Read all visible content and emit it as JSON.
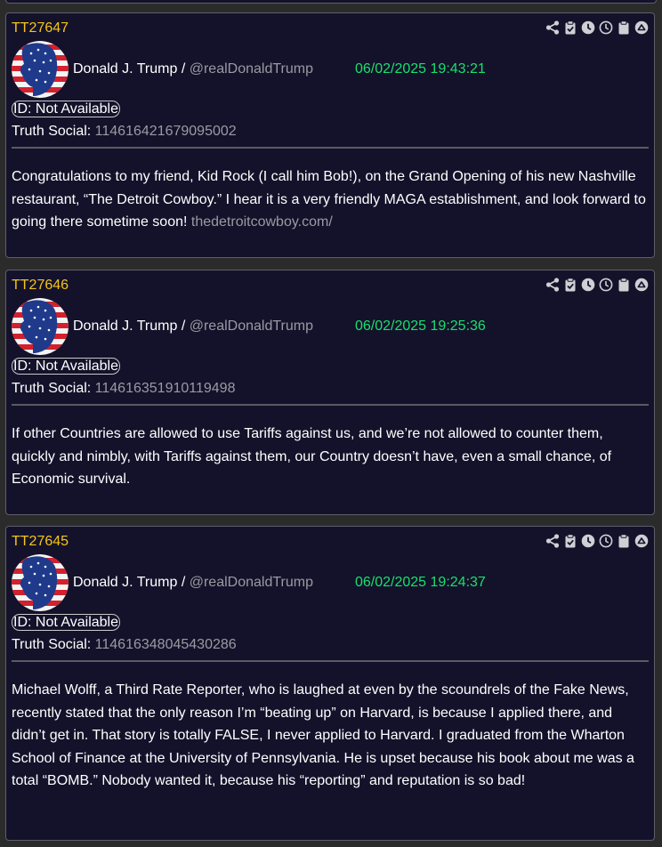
{
  "posts": [
    {
      "id": "TT27647",
      "author_name": "Donald J. Trump",
      "separator": " / ",
      "author_handle": "@realDonaldTrump",
      "timestamp": "06/02/2025 19:43:21",
      "id_pill": "ID: Not Available",
      "platform_label": "Truth Social: ",
      "platform_id": "114616421679095002",
      "body": "Congratulations to my friend, Kid Rock (I call him Bob!), on the Grand Opening of his new Nashville restaurant, “The Detroit Cowboy.” I hear it is a very friendly MAGA establishment, and look forward to going there sometime soon! ",
      "link": "thedetroitcowboy.com/"
    },
    {
      "id": "TT27646",
      "author_name": "Donald J. Trump",
      "separator": " / ",
      "author_handle": "@realDonaldTrump",
      "timestamp": "06/02/2025 19:25:36",
      "id_pill": "ID: Not Available",
      "platform_label": "Truth Social: ",
      "platform_id": "114616351910119498",
      "body": "If other Countries are allowed to use Tariffs against us, and we’re not allowed to counter them, quickly and nimbly, with Tariffs against them, our Country doesn’t have, even a small chance, of Economic survival.",
      "link": ""
    },
    {
      "id": "TT27645",
      "author_name": "Donald J. Trump",
      "separator": " / ",
      "author_handle": "@realDonaldTrump",
      "timestamp": "06/02/2025 19:24:37",
      "id_pill": "ID: Not Available",
      "platform_label": "Truth Social: ",
      "platform_id": "114616348045430286",
      "body": "Michael Wolff, a Third Rate Reporter, who is laughed at even by the scoundrels of the Fake News, recently stated that the only reason I’m “beating up” on Harvard, is because I applied there, and didn’t get in. That story is totally FALSE, I never applied to Harvard. I graduated from the Wharton School of Finance at the University of Pennsylvania. He is upset because his book about me was a total “BOMB.” Nobody wanted it, because his “reporting” and reputation is so bad!",
      "link": ""
    }
  ],
  "toolbar_icons": [
    "share-icon",
    "clipboard-check-icon",
    "clock-filled-icon",
    "clock-outline-icon",
    "clipboard-icon",
    "scroll-up-icon"
  ],
  "colors": {
    "page_bg": "#2b2b2b",
    "card_bg": "#14122a",
    "post_id": "#f5c518",
    "timestamp": "#18e06c",
    "muted": "#9a9aa2",
    "text": "#ffffff"
  }
}
